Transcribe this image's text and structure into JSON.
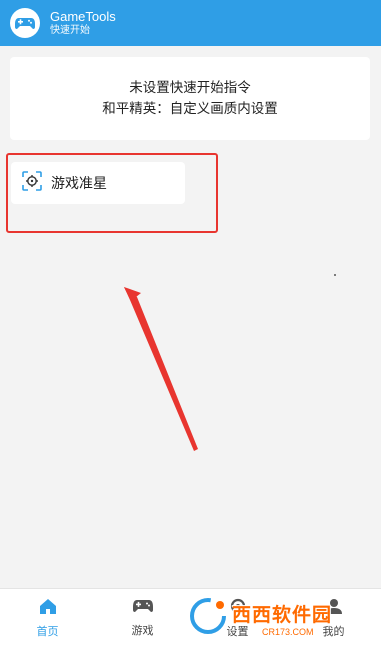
{
  "header": {
    "title": "GameTools",
    "subtitle": "快速开始",
    "logo_icon": "gamepad-icon",
    "color": "#2f9ee6"
  },
  "info_card": {
    "line1": "未设置快速开始指令",
    "line2": "和平精英：自定义画质内设置"
  },
  "feature_list": [
    {
      "label": "游戏准星",
      "icon": "crosshair-icon"
    }
  ],
  "annotation": {
    "highlight_color": "#e8352f"
  },
  "bottom_nav": {
    "items": [
      {
        "label": "首页",
        "icon": "home-icon",
        "active": true
      },
      {
        "label": "游戏",
        "icon": "gamepad-icon",
        "active": false
      },
      {
        "label": "设置",
        "icon": "settings-icon",
        "active": false
      },
      {
        "label": "我的",
        "icon": "profile-icon",
        "active": false
      }
    ]
  },
  "watermark": {
    "brand": "西西软件园",
    "url": "CR173.COM"
  }
}
